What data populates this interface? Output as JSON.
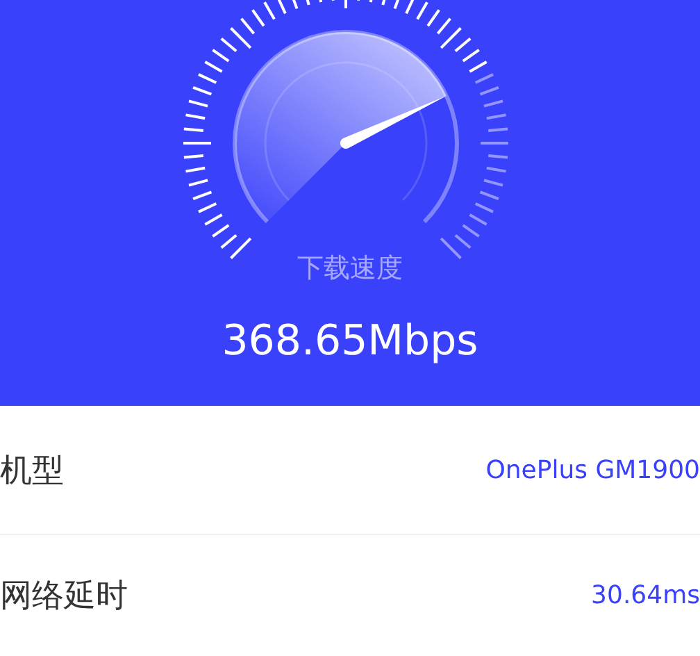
{
  "gauge": {
    "label": "下载速度",
    "reading": "368.65Mbps"
  },
  "rows": [
    {
      "label": "机型",
      "value": "OnePlus GM1900"
    },
    {
      "label": "网络延时",
      "value": "30.64ms"
    }
  ]
}
